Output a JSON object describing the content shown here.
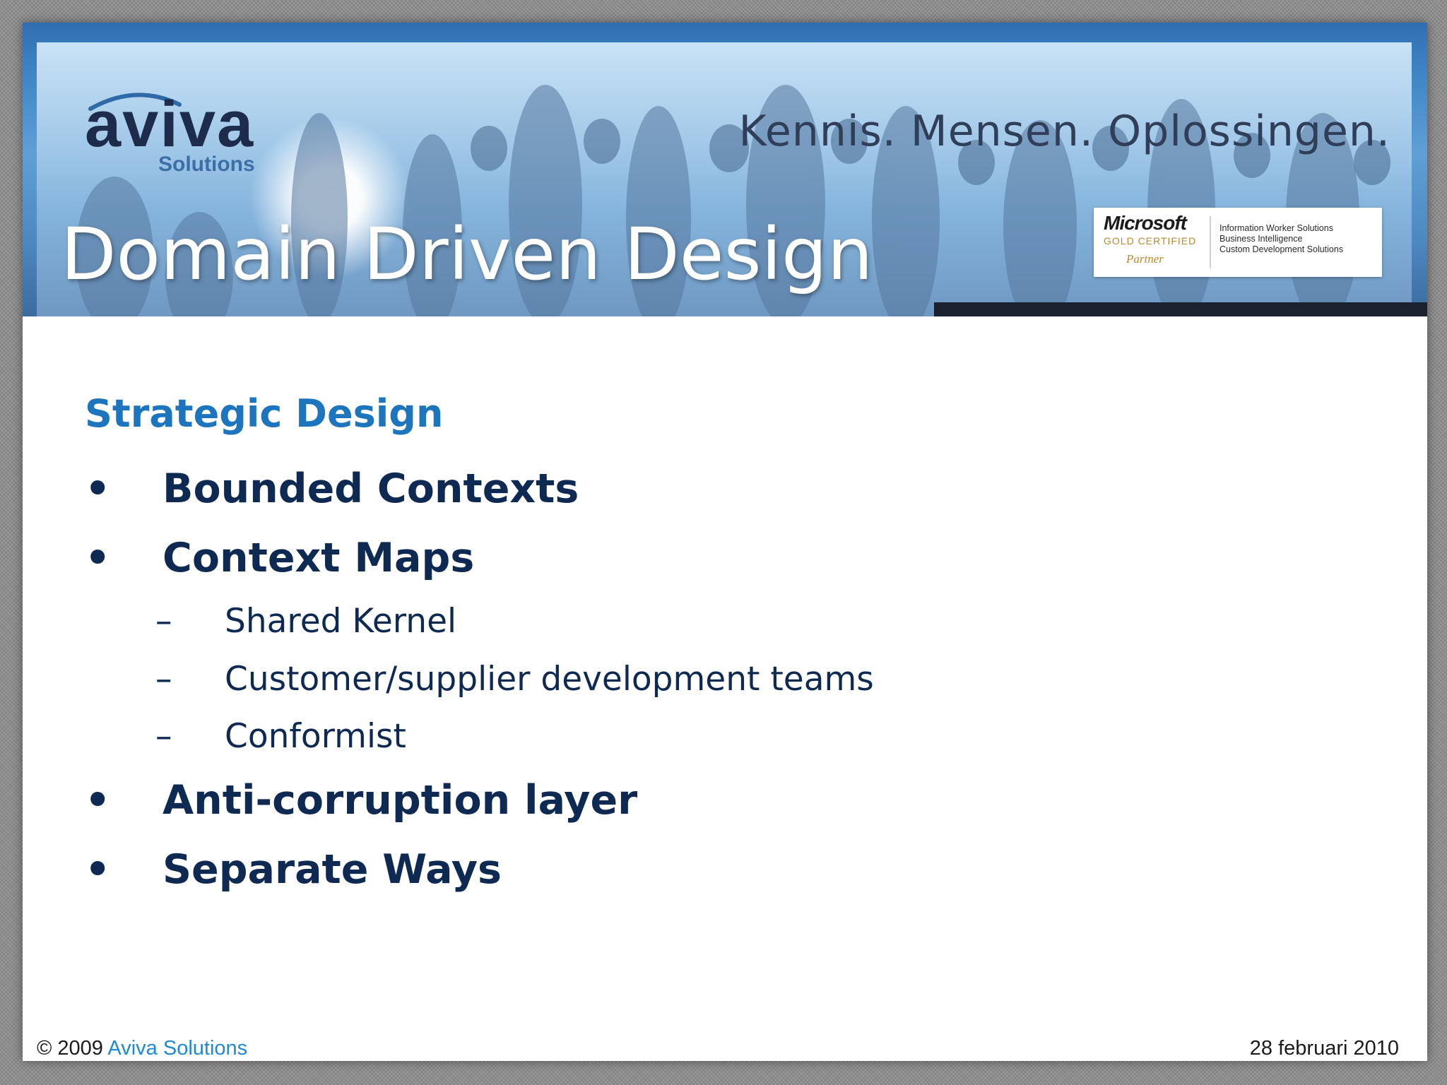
{
  "header": {
    "logo_word": "aviva",
    "logo_sub": "Solutions",
    "tagline": "Kennis. Mensen. Oplossingen.",
    "title": "Domain Driven Design",
    "badge": {
      "brand": "Microsoft",
      "certification": "GOLD CERTIFIED",
      "partner": "Partner",
      "competencies": [
        "Information Worker Solutions",
        "Business Intelligence",
        "Custom Development Solutions"
      ]
    }
  },
  "content": {
    "heading": "Strategic Design",
    "bullets": [
      {
        "level": 1,
        "marker": "•",
        "text": "Bounded Contexts"
      },
      {
        "level": 1,
        "marker": "•",
        "text": "Context Maps"
      },
      {
        "level": 2,
        "marker": "–",
        "text": "Shared Kernel"
      },
      {
        "level": 2,
        "marker": "–",
        "text": "Customer/supplier development teams"
      },
      {
        "level": 2,
        "marker": "–",
        "text": "Conformist"
      },
      {
        "level": 1,
        "marker": "•",
        "text": "Anti-corruption layer"
      },
      {
        "level": 1,
        "marker": "•",
        "text": "Separate Ways"
      }
    ]
  },
  "footer": {
    "copyright": "© 2009",
    "company": "Aviva Solutions",
    "date": "28 februari 2010"
  },
  "colors": {
    "heading_accent": "#1c75bd",
    "body_text": "#0f2a52",
    "company_link": "#1c8ad6",
    "banner_blue": "#3f86c6"
  }
}
